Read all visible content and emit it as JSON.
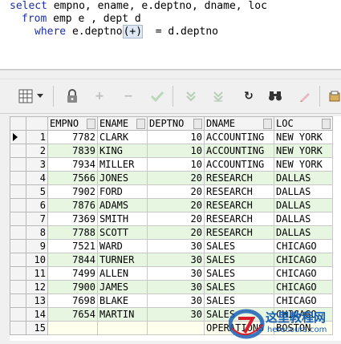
{
  "sql": {
    "line1": {
      "kw": "select",
      "rest": " empno, ename, e.deptno, dname, loc"
    },
    "line2": {
      "kw": "from",
      "rest": " emp e , dept d"
    },
    "line3": {
      "kw": "where",
      "pre": " e.deptno",
      "paren": "(+)",
      "post": "  = d.deptno"
    }
  },
  "toolbar": {
    "icons": [
      "grid-icon",
      "dropdown-arrow-icon",
      "lock-icon",
      "add-icon",
      "remove-icon",
      "check-icon",
      "post-down-icon",
      "post-down-double-icon",
      "refresh-icon",
      "find-icon",
      "clear-icon",
      "export-icon"
    ]
  },
  "grid": {
    "columns": [
      "EMPNO",
      "ENAME",
      "DEPTNO",
      "DNAME",
      "LOC"
    ],
    "rows": [
      {
        "n": "1",
        "empno": "7782",
        "ename": "CLARK",
        "deptno": "10",
        "dname": "ACCOUNTING",
        "loc": "NEW YORK"
      },
      {
        "n": "2",
        "empno": "7839",
        "ename": "KING",
        "deptno": "10",
        "dname": "ACCOUNTING",
        "loc": "NEW YORK"
      },
      {
        "n": "3",
        "empno": "7934",
        "ename": "MILLER",
        "deptno": "10",
        "dname": "ACCOUNTING",
        "loc": "NEW YORK"
      },
      {
        "n": "4",
        "empno": "7566",
        "ename": "JONES",
        "deptno": "20",
        "dname": "RESEARCH",
        "loc": "DALLAS"
      },
      {
        "n": "5",
        "empno": "7902",
        "ename": "FORD",
        "deptno": "20",
        "dname": "RESEARCH",
        "loc": "DALLAS"
      },
      {
        "n": "6",
        "empno": "7876",
        "ename": "ADAMS",
        "deptno": "20",
        "dname": "RESEARCH",
        "loc": "DALLAS"
      },
      {
        "n": "7",
        "empno": "7369",
        "ename": "SMITH",
        "deptno": "20",
        "dname": "RESEARCH",
        "loc": "DALLAS"
      },
      {
        "n": "8",
        "empno": "7788",
        "ename": "SCOTT",
        "deptno": "20",
        "dname": "RESEARCH",
        "loc": "DALLAS"
      },
      {
        "n": "9",
        "empno": "7521",
        "ename": "WARD",
        "deptno": "30",
        "dname": "SALES",
        "loc": "CHICAGO"
      },
      {
        "n": "10",
        "empno": "7844",
        "ename": "TURNER",
        "deptno": "30",
        "dname": "SALES",
        "loc": "CHICAGO"
      },
      {
        "n": "11",
        "empno": "7499",
        "ename": "ALLEN",
        "deptno": "30",
        "dname": "SALES",
        "loc": "CHICAGO"
      },
      {
        "n": "12",
        "empno": "7900",
        "ename": "JAMES",
        "deptno": "30",
        "dname": "SALES",
        "loc": "CHICAGO"
      },
      {
        "n": "13",
        "empno": "7698",
        "ename": "BLAKE",
        "deptno": "30",
        "dname": "SALES",
        "loc": "CHICAGO"
      },
      {
        "n": "14",
        "empno": "7654",
        "ename": "MARTIN",
        "deptno": "30",
        "dname": "SALES",
        "loc": "CHICAGO"
      },
      {
        "n": "15",
        "empno": "",
        "ename": "",
        "deptno": "",
        "dname": "OPERATIONS",
        "loc": "BOSTON"
      }
    ]
  },
  "watermark": {
    "title": "这里教程网",
    "url": "herecours.com"
  },
  "colors": {
    "keyword": "#1c2ea8",
    "row_alt": "#e6f6e0",
    "empty_row": "#ffffee"
  }
}
